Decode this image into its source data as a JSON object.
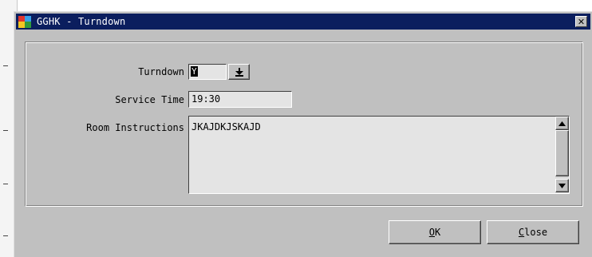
{
  "window": {
    "title": "GGHK - Turndown",
    "app_icon": "app-icon",
    "close_glyph": "✕"
  },
  "form": {
    "turndown_label": "Turndown",
    "turndown_value": "Y",
    "service_time_label": "Service Time",
    "service_time_value": "19:30",
    "room_instructions_label": "Room Instructions",
    "room_instructions_value": "JKAJDKJSKAJD"
  },
  "buttons": {
    "ok_mnemonic": "O",
    "ok_rest": "K",
    "close_mnemonic": "C",
    "close_rest": "lose"
  },
  "icons": {
    "dropdown": "dropdown-arrow-icon",
    "scroll_up": "scroll-up-icon",
    "scroll_down": "scroll-down-icon"
  }
}
